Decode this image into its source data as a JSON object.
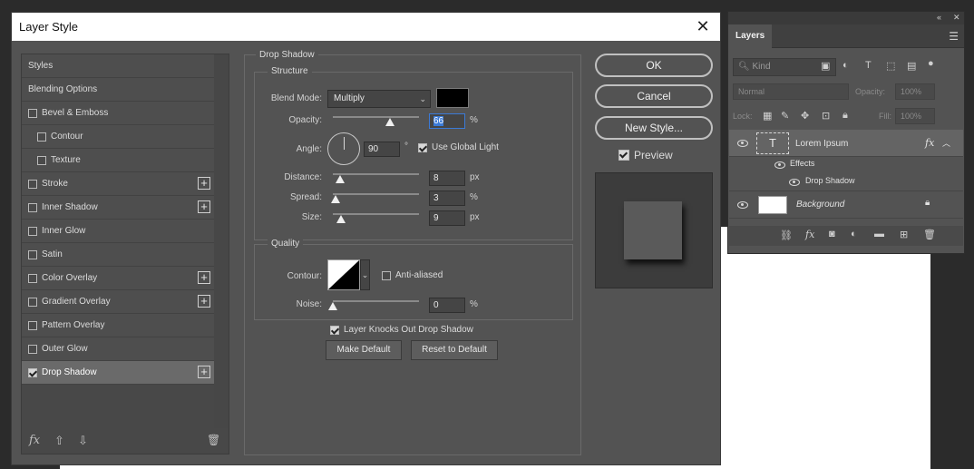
{
  "dialog": {
    "title": "Layer Style",
    "close_symbol": "✕",
    "styles_list": [
      {
        "label": "Styles",
        "checkbox": false,
        "checked": false,
        "plus": false,
        "sub": false
      },
      {
        "label": "Blending Options",
        "checkbox": false,
        "checked": false,
        "plus": false,
        "sub": false
      },
      {
        "label": "Bevel & Emboss",
        "checkbox": true,
        "checked": false,
        "plus": false,
        "sub": false
      },
      {
        "label": "Contour",
        "checkbox": true,
        "checked": false,
        "plus": false,
        "sub": true
      },
      {
        "label": "Texture",
        "checkbox": true,
        "checked": false,
        "plus": false,
        "sub": true
      },
      {
        "label": "Stroke",
        "checkbox": true,
        "checked": false,
        "plus": true,
        "sub": false
      },
      {
        "label": "Inner Shadow",
        "checkbox": true,
        "checked": false,
        "plus": true,
        "sub": false
      },
      {
        "label": "Inner Glow",
        "checkbox": true,
        "checked": false,
        "plus": false,
        "sub": false
      },
      {
        "label": "Satin",
        "checkbox": true,
        "checked": false,
        "plus": false,
        "sub": false
      },
      {
        "label": "Color Overlay",
        "checkbox": true,
        "checked": false,
        "plus": true,
        "sub": false
      },
      {
        "label": "Gradient Overlay",
        "checkbox": true,
        "checked": false,
        "plus": true,
        "sub": false
      },
      {
        "label": "Pattern Overlay",
        "checkbox": true,
        "checked": false,
        "plus": false,
        "sub": false
      },
      {
        "label": "Outer Glow",
        "checkbox": true,
        "checked": false,
        "plus": false,
        "sub": false
      },
      {
        "label": "Drop Shadow",
        "checkbox": true,
        "checked": true,
        "plus": true,
        "sub": false,
        "active": true
      }
    ],
    "footer": {
      "fx": "fx",
      "up": "⇧",
      "down": "⇩",
      "trash": "🗑"
    },
    "drop_shadow": {
      "section_title": "Drop Shadow",
      "structure_title": "Structure",
      "blend_mode_label": "Blend Mode:",
      "blend_mode_value": "Multiply",
      "shadow_color": "#000000",
      "opacity_label": "Opacity:",
      "opacity_value": "66",
      "angle_label": "Angle:",
      "angle_value": "90",
      "angle_unit": "°",
      "use_global_light_label": "Use Global Light",
      "use_global_light": true,
      "distance_label": "Distance:",
      "distance_value": "8",
      "spread_label": "Spread:",
      "spread_value": "3",
      "size_label": "Size:",
      "size_value": "9",
      "quality_title": "Quality",
      "contour_label": "Contour:",
      "anti_aliased_label": "Anti-aliased",
      "anti_aliased": false,
      "noise_label": "Noise:",
      "noise_value": "0",
      "knockout_label": "Layer Knocks Out Drop Shadow",
      "knockout": true,
      "make_default_label": "Make Default",
      "reset_default_label": "Reset to Default",
      "unit_percent": "%",
      "unit_px": "px"
    },
    "sliders": {
      "opacity": 0.66,
      "distance": 0.08,
      "spread": 0.03,
      "size": 0.09,
      "noise": 0.0
    },
    "buttons": {
      "ok": "OK",
      "cancel": "Cancel",
      "new_style": "New Style...",
      "preview_label": "Preview",
      "preview_checked": true
    }
  },
  "layers_panel": {
    "collapse_symbol": "«",
    "close_symbol": "✕",
    "tab": "Layers",
    "filter_placeholder": "Kind",
    "blend_mode": "Normal",
    "opacity_label": "Opacity:",
    "opacity_value": "100%",
    "lock_label": "Lock:",
    "fill_label": "Fill:",
    "fill_value": "100%",
    "layers": [
      {
        "name": "Lorem Ipsum",
        "type": "text",
        "fx": "fx"
      },
      {
        "name": "Effects",
        "type": "effects-group"
      },
      {
        "name": "Drop Shadow",
        "type": "effect"
      },
      {
        "name": "Background",
        "type": "background",
        "locked": true
      }
    ]
  }
}
